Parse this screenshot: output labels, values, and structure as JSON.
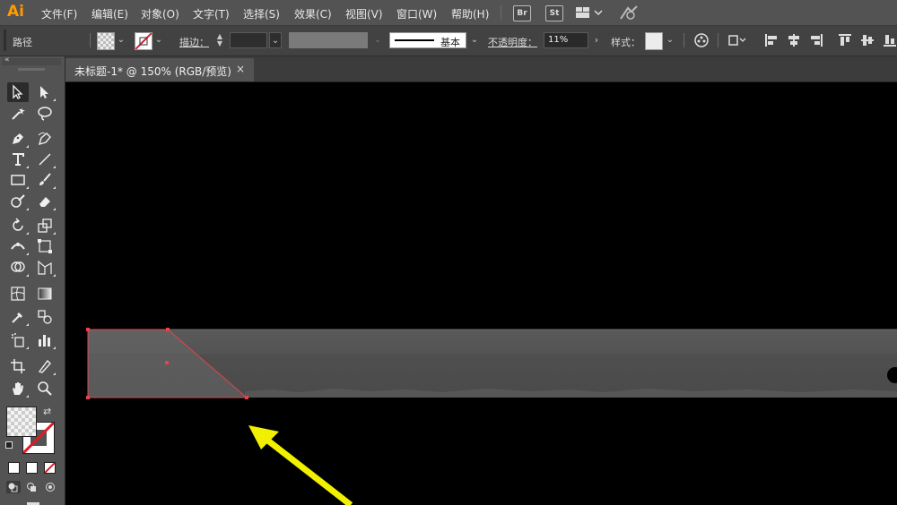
{
  "app": {
    "logo": "Ai",
    "brand_color": "#FF9A00"
  },
  "menubar": {
    "items": [
      "文件(F)",
      "编辑(E)",
      "对象(O)",
      "文字(T)",
      "选择(S)",
      "效果(C)",
      "视图(V)",
      "窗口(W)",
      "帮助(H)"
    ],
    "bridge_label": "Br",
    "stock_label": "St"
  },
  "controlbar": {
    "object_type": "路径",
    "stroke_label": "描边：",
    "stroke_style": "基本",
    "opacity_label": "不透明度：",
    "opacity_value": "11%",
    "style_label": "样式："
  },
  "document": {
    "tab_title": "未标题-1* @ 150% (RGB/预览)",
    "close_glyph": "×"
  },
  "icons": {
    "selection": "selection-tool-icon",
    "direct_selection": "direct-selection-tool-icon",
    "arrow_annotation": "yellow-arrow-icon"
  },
  "colors": {
    "annotation_arrow": "#F0F000",
    "selection_highlight": "#E8434B",
    "panel_bg": "#535353",
    "control_bg": "#424242"
  }
}
